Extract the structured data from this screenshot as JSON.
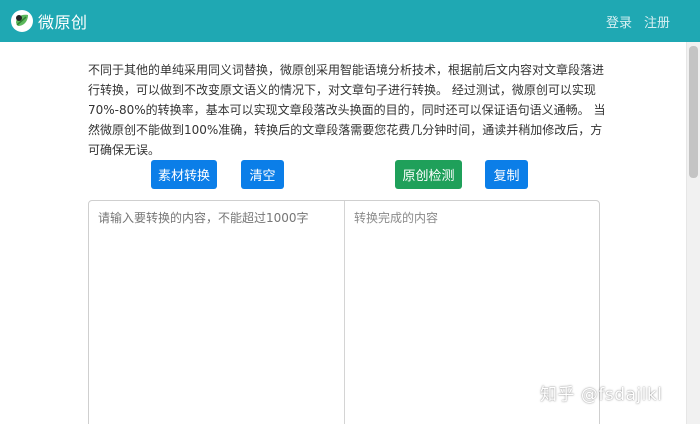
{
  "header": {
    "brand_name": "微原创",
    "brand_logo_icon": "leaf-logo-icon",
    "nav": {
      "login": "登录",
      "register": "注册"
    },
    "bg_color": "#1fa8b3"
  },
  "intro": {
    "text": "不同于其他的单纯采用同义词替换，微原创采用智能语境分析技术，根据前后文内容对文章段落进行转换，可以做到不改变原文语义的情况下，对文章句子进行转换。 经过测试，微原创可以实现70%-80%的转换率，基本可以实现文章段落改头换面的目的，同时还可以保证语句语义通畅。 当然微原创不能做到100%准确，转换后的文章段落需要您花费几分钟时间，通读并稍加修改后，方可确保无误。"
  },
  "toolbar": {
    "convert_label": "素材转换",
    "clear_label": "清空",
    "check_label": "原创检测",
    "copy_label": "复制",
    "primary_color": "#0b7ee8",
    "success_color": "#1fa05a"
  },
  "editor": {
    "input_placeholder": "请输入要转换的内容，不能超过1000字",
    "output_placeholder": "转换完成的内容"
  },
  "watermark": {
    "text": "知乎 @fsdajlkl"
  }
}
